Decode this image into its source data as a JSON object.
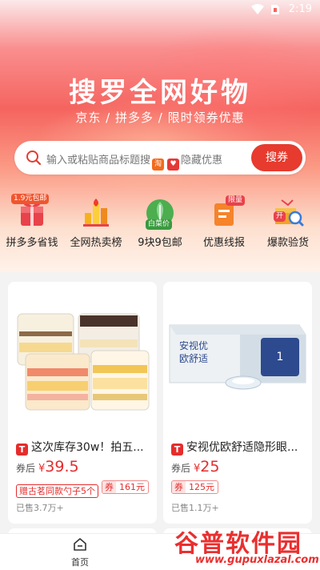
{
  "status_bar": {
    "time": "2:19"
  },
  "hero": {
    "title": "搜罗全网好物",
    "subtitle": "京东 / 拼多多 / 限时领券优惠"
  },
  "search": {
    "placeholder_prefix": "输入或粘贴商品标题搜",
    "placeholder_suffix": "隐藏优惠",
    "taobao_mark": "淘",
    "button_label": "搜券"
  },
  "categories": [
    {
      "label": "拼多多省钱",
      "badge": "1.9元包邮",
      "icon": "pinduoduo-gift-icon"
    },
    {
      "label": "全网热卖榜",
      "icon": "hot-sale-chart-icon"
    },
    {
      "label": "9块9包邮",
      "badge": "白菜价",
      "icon": "cabbage-icon"
    },
    {
      "label": "优惠线报",
      "badge": "限量",
      "icon": "deal-report-icon"
    },
    {
      "label": "爆款验货",
      "badge": "开",
      "icon": "inspect-box-icon"
    }
  ],
  "products": [
    {
      "title": "这次库存30w！拍五...",
      "price_label": "券后",
      "currency": "¥",
      "price": "39.5",
      "gift_tag": "赠古茗同款勺子5个",
      "coupon_label": "券",
      "coupon_value": "161元",
      "sold": "已售3.7万+",
      "platform_badge": "T"
    },
    {
      "title": "安视优欧舒适隐形眼...",
      "price_label": "券后",
      "currency": "¥",
      "price": "25",
      "coupon_label": "券",
      "coupon_value": "125元",
      "sold": "已售1.1万+",
      "platform_badge": "T",
      "image_brand_text": "安视优",
      "image_product_text": "欧舒适"
    }
  ],
  "tabbar": {
    "home_label": "首页"
  },
  "watermark": {
    "text": "谷普软件园",
    "url": "www.gupuxlazal.com"
  },
  "colors": {
    "accent": "#e63b2e",
    "price_red": "#e62c2c"
  }
}
